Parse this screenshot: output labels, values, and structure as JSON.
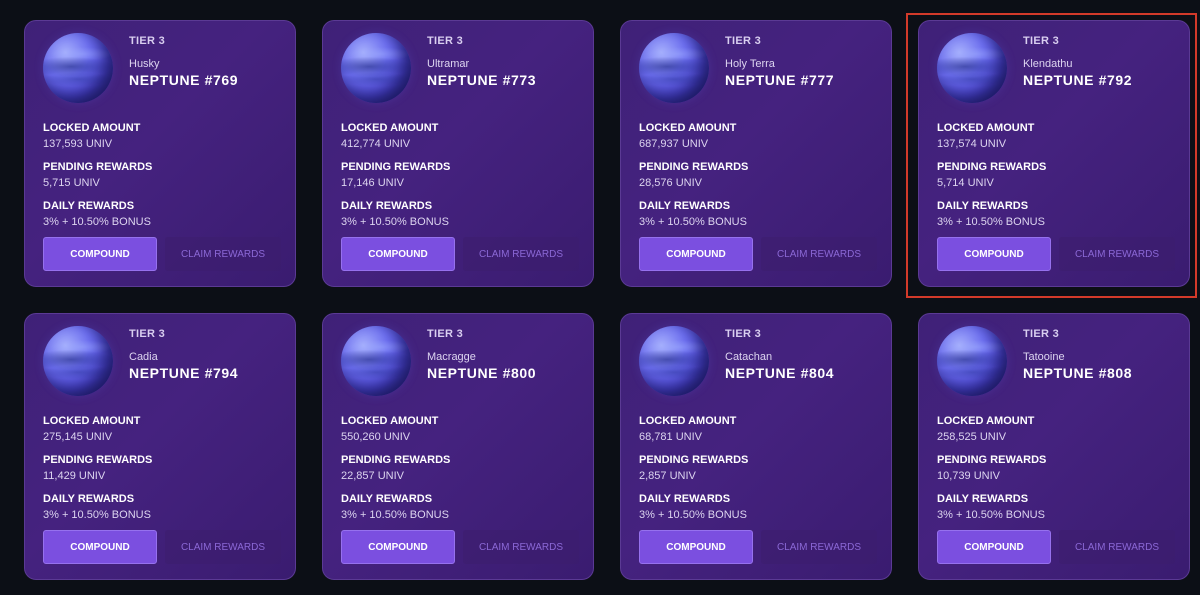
{
  "cards": [
    {
      "tier": "TIER 3",
      "nickname": "Husky",
      "title": "NEPTUNE #769",
      "locked_label": "LOCKED AMOUNT",
      "locked_value": "137,593 UNIV",
      "pending_label": "PENDING REWARDS",
      "pending_value": "5,715 UNIV",
      "daily_label": "DAILY REWARDS",
      "daily_value": "3% + 10.50% BONUS",
      "compound_label": "COMPOUND",
      "claim_label": "CLAIM REWARDS",
      "planet_icon": "neptune-planet-icon"
    },
    {
      "tier": "TIER 3",
      "nickname": "Ultramar",
      "title": "NEPTUNE #773",
      "locked_label": "LOCKED AMOUNT",
      "locked_value": "412,774 UNIV",
      "pending_label": "PENDING REWARDS",
      "pending_value": "17,146 UNIV",
      "daily_label": "DAILY REWARDS",
      "daily_value": "3% + 10.50% BONUS",
      "compound_label": "COMPOUND",
      "claim_label": "CLAIM REWARDS",
      "planet_icon": "neptune-planet-icon"
    },
    {
      "tier": "TIER 3",
      "nickname": "Holy Terra",
      "title": "NEPTUNE #777",
      "locked_label": "LOCKED AMOUNT",
      "locked_value": "687,937 UNIV",
      "pending_label": "PENDING REWARDS",
      "pending_value": "28,576 UNIV",
      "daily_label": "DAILY REWARDS",
      "daily_value": "3% + 10.50% BONUS",
      "compound_label": "COMPOUND",
      "claim_label": "CLAIM REWARDS",
      "planet_icon": "neptune-planet-icon"
    },
    {
      "tier": "TIER 3",
      "nickname": "Klendathu",
      "title": "NEPTUNE #792",
      "locked_label": "LOCKED AMOUNT",
      "locked_value": "137,574 UNIV",
      "pending_label": "PENDING REWARDS",
      "pending_value": "5,714 UNIV",
      "daily_label": "DAILY REWARDS",
      "daily_value": "3% + 10.50% BONUS",
      "compound_label": "COMPOUND",
      "claim_label": "CLAIM REWARDS",
      "planet_icon": "neptune-planet-icon"
    },
    {
      "tier": "TIER 3",
      "nickname": "Cadia",
      "title": "NEPTUNE #794",
      "locked_label": "LOCKED AMOUNT",
      "locked_value": "275,145 UNIV",
      "pending_label": "PENDING REWARDS",
      "pending_value": "11,429 UNIV",
      "daily_label": "DAILY REWARDS",
      "daily_value": "3% + 10.50% BONUS",
      "compound_label": "COMPOUND",
      "claim_label": "CLAIM REWARDS",
      "planet_icon": "neptune-planet-icon"
    },
    {
      "tier": "TIER 3",
      "nickname": "Macragge",
      "title": "NEPTUNE #800",
      "locked_label": "LOCKED AMOUNT",
      "locked_value": "550,260 UNIV",
      "pending_label": "PENDING REWARDS",
      "pending_value": "22,857 UNIV",
      "daily_label": "DAILY REWARDS",
      "daily_value": "3% + 10.50% BONUS",
      "compound_label": "COMPOUND",
      "claim_label": "CLAIM REWARDS",
      "planet_icon": "neptune-planet-icon"
    },
    {
      "tier": "TIER 3",
      "nickname": "Catachan",
      "title": "NEPTUNE #804",
      "locked_label": "LOCKED AMOUNT",
      "locked_value": "68,781 UNIV",
      "pending_label": "PENDING REWARDS",
      "pending_value": "2,857 UNIV",
      "daily_label": "DAILY REWARDS",
      "daily_value": "3% + 10.50% BONUS",
      "compound_label": "COMPOUND",
      "claim_label": "CLAIM REWARDS",
      "planet_icon": "neptune-planet-icon"
    },
    {
      "tier": "TIER 3",
      "nickname": "Tatooine",
      "title": "NEPTUNE #808",
      "locked_label": "LOCKED AMOUNT",
      "locked_value": "258,525 UNIV",
      "pending_label": "PENDING REWARDS",
      "pending_value": "10,739 UNIV",
      "daily_label": "DAILY REWARDS",
      "daily_value": "3% + 10.50% BONUS",
      "compound_label": "COMPOUND",
      "claim_label": "CLAIM REWARDS",
      "planet_icon": "neptune-planet-icon"
    }
  ],
  "colors": {
    "page_background": "#0c0f16",
    "card_background": "#41207a",
    "compound_button": "#7b4fe0",
    "claim_text": "#8b68d6",
    "highlight_outline": "#d23a2a"
  }
}
